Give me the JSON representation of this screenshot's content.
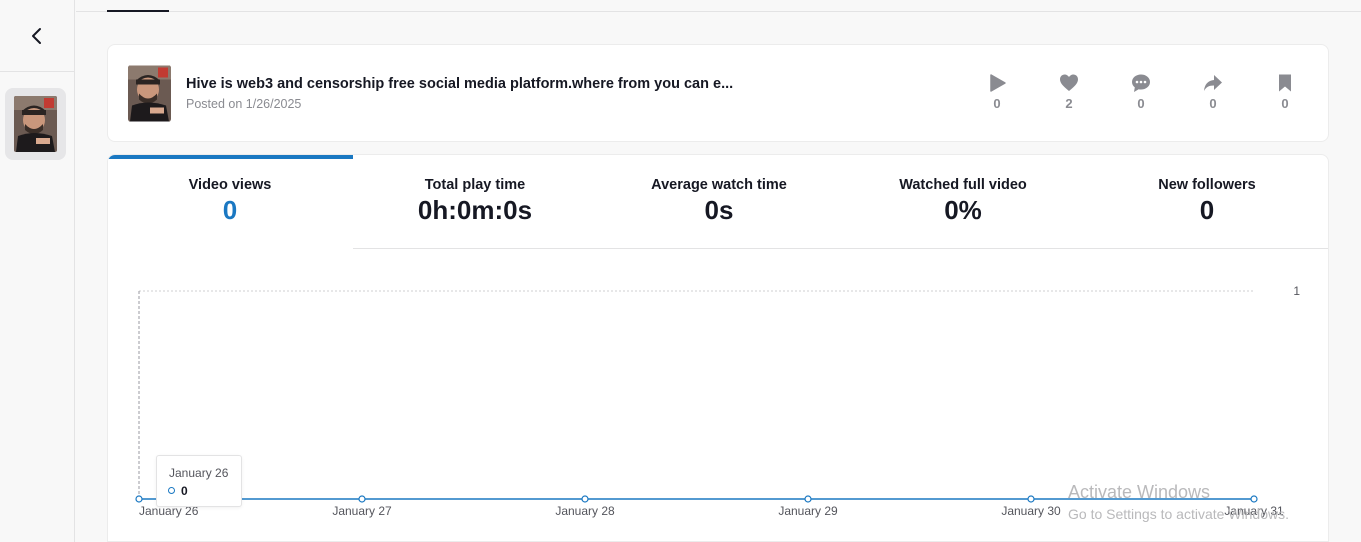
{
  "post": {
    "title": "Hive is web3 and censorship free social media platform.where from you can e...",
    "date": "Posted on 1/26/2025",
    "stats": [
      {
        "name": "plays",
        "icon": "play-icon",
        "value": "0"
      },
      {
        "name": "likes",
        "icon": "heart-icon",
        "value": "2"
      },
      {
        "name": "comments",
        "icon": "comment-icon",
        "value": "0"
      },
      {
        "name": "shares",
        "icon": "share-icon",
        "value": "0"
      },
      {
        "name": "saves",
        "icon": "bookmark-icon",
        "value": "0"
      }
    ]
  },
  "metrics": [
    {
      "label": "Video views",
      "value": "0",
      "active": true
    },
    {
      "label": "Total play time",
      "value": "0h:0m:0s"
    },
    {
      "label": "Average watch time",
      "value": "0s"
    },
    {
      "label": "Watched full video",
      "value": "0%"
    },
    {
      "label": "New followers",
      "value": "0"
    }
  ],
  "chart_data": {
    "type": "line",
    "categories": [
      "January 26",
      "January 27",
      "January 28",
      "January 29",
      "January 30",
      "January 31"
    ],
    "series": [
      {
        "values": [
          0,
          0,
          0,
          0,
          0,
          0
        ]
      }
    ],
    "ylim": [
      0,
      1
    ],
    "y_ticks": [
      "1"
    ],
    "grid": true,
    "color": "#1a78c2"
  },
  "tooltip": {
    "date": "January 26",
    "value": "0"
  },
  "watermark": {
    "line1": "Activate Windows",
    "line2": "Go to Settings to activate Windows."
  },
  "colors": {
    "accent": "#1a78c2",
    "icon_gray": "#8a8b91"
  }
}
